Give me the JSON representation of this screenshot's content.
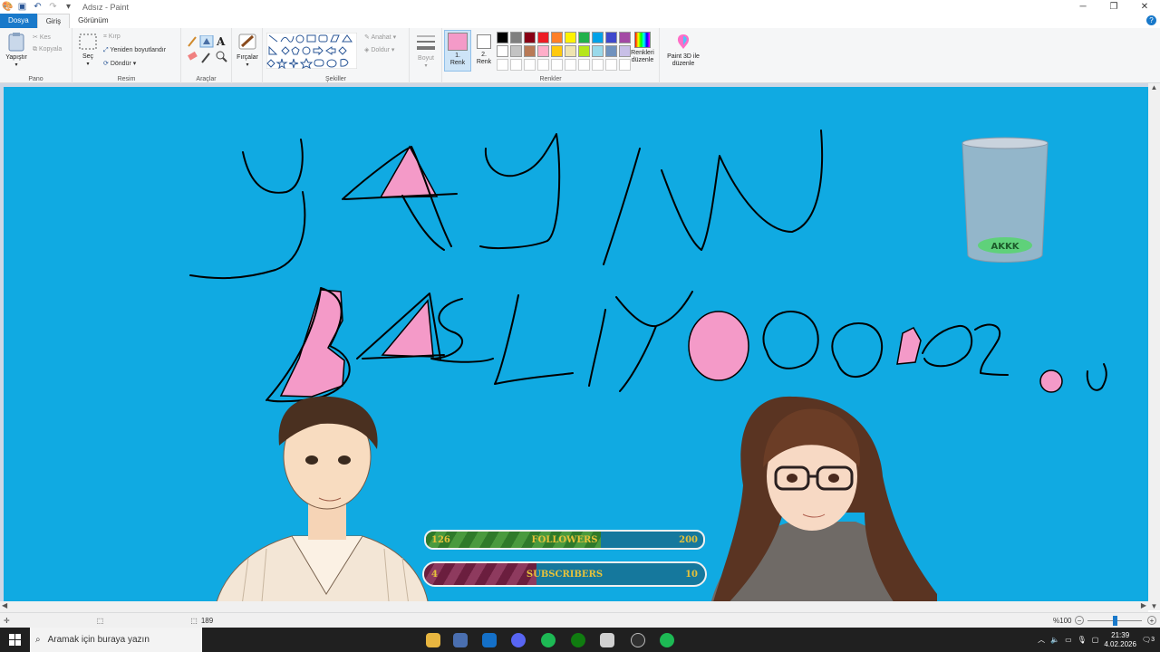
{
  "window": {
    "title": "Adsız - Paint",
    "controls": [
      "─",
      "❐",
      "✕"
    ]
  },
  "tabs": {
    "file": "Dosya",
    "home": "Giriş",
    "view": "Görünüm"
  },
  "ribbon": {
    "clipboard": {
      "label": "Pano",
      "paste": "Yapıştır",
      "cut": "Kes",
      "copy": "Kopyala"
    },
    "image": {
      "label": "Resim",
      "select": "Seç",
      "crop": "Kırp",
      "resize": "Yeniden boyutlandır",
      "rotate": "Döndür"
    },
    "tools": {
      "label": "Araçlar"
    },
    "brushes": {
      "label": "Fırçalar"
    },
    "shapes": {
      "label": "Şekiller",
      "outline": "Anahat",
      "fill": "Doldur"
    },
    "size": {
      "label": "Boyut"
    },
    "colors": {
      "label": "Renkler",
      "color1_line1": "1.",
      "color1_line2": "Renk",
      "color2_line1": "2.",
      "color2_line2": "Renk",
      "edit_line1": "Renkleri",
      "edit_line2": "düzenle",
      "color1": "#f49ac8",
      "color2": "#ffffff",
      "palette_row1": [
        "#000000",
        "#7f7f7f",
        "#880015",
        "#ed1c24",
        "#ff7f27",
        "#fff200",
        "#22b14c",
        "#00a2e8",
        "#3f48cc",
        "#a349a4"
      ],
      "palette_row2": [
        "#ffffff",
        "#c3c3c3",
        "#b97a57",
        "#ffaec9",
        "#ffc90e",
        "#efe4b0",
        "#b5e61d",
        "#99d9ea",
        "#7092be",
        "#c8bfe7"
      ]
    },
    "paint3d": {
      "line1": "Paint 3D ile",
      "line2": "düzenle"
    }
  },
  "overlay": {
    "followers": {
      "label": "FOLLOWERS",
      "current": "126",
      "goal": "200",
      "progress": 0.63
    },
    "subscribers": {
      "label": "SUBSCRIBERS",
      "current": "4",
      "goal": "10",
      "progress": 0.4
    },
    "jar_letters": "AKKK"
  },
  "status": {
    "size": "189",
    "zoom": "%100",
    "zoom_level": 1.0
  },
  "taskbar": {
    "search_placeholder": "Aramak için buraya yazın",
    "time": "21:39",
    "date": "4.02.2026",
    "notification_count": "3"
  },
  "colors": {
    "canvas": "#10aae2",
    "ribbon": "#f5f6f7",
    "accent": "#1979ca",
    "highlight": "#f49ac8"
  }
}
